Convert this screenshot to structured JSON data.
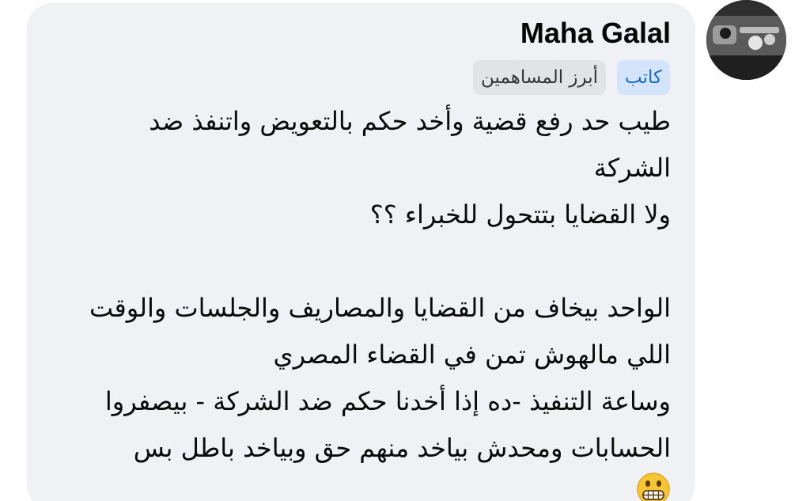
{
  "comment": {
    "author": "Maha Galal",
    "badges": {
      "writer": "كاتب",
      "top_contributor": "أبرز المساهمين"
    },
    "lines": [
      "طيب حد رفع قضية وأخد حكم بالتعويض واتنفذ ضد",
      "الشركة",
      "ولا القضايا بتتحول للخبراء ؟؟",
      "",
      "الواحد بيخاف من القضايا والمصاريف والجلسات والوقت",
      "اللي مالهوش تمن في القضاء المصري",
      "وساعة التنفيذ -ده إذا أخدنا حكم ضد الشركة - بيصفروا",
      "الحسابات ومحدش بياخد منهم حق وبياخد باطل بس"
    ],
    "emoji_icon": "grimacing-face-icon"
  },
  "colors": {
    "bubble_bg": "#f0f1f4",
    "writer_badge_bg": "#d3e4fb",
    "writer_badge_text": "#1b6ac9",
    "top_badge_bg": "#e2e3e7",
    "text": "#0a0a0a"
  }
}
